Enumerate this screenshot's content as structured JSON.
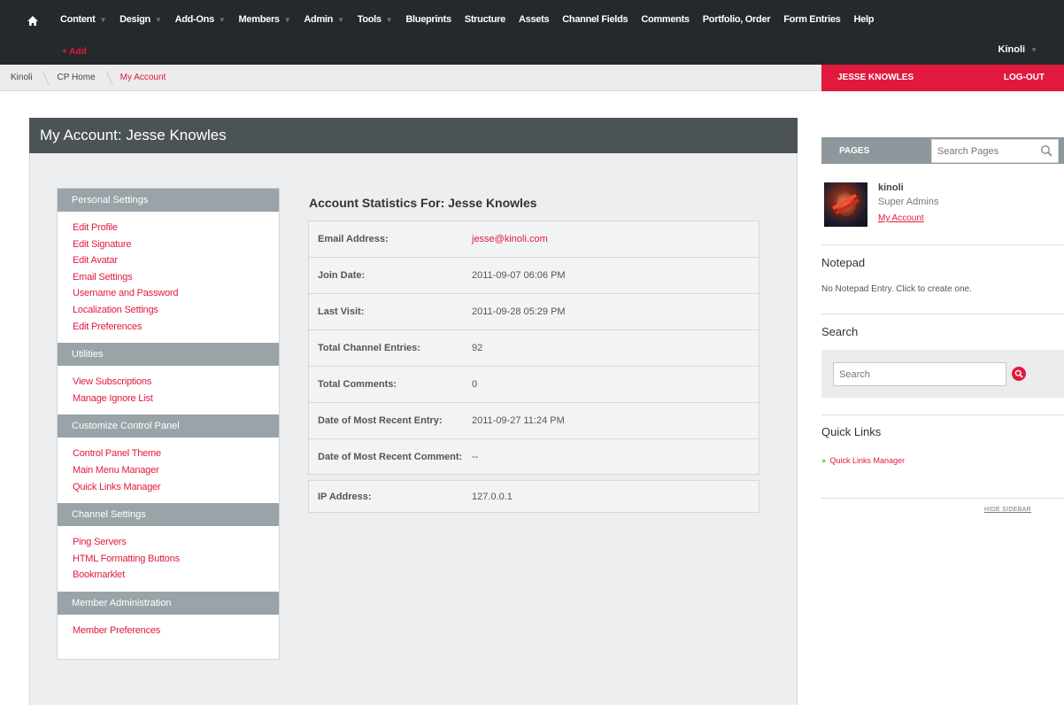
{
  "topnav": {
    "items": [
      {
        "label": "Content",
        "caret": true
      },
      {
        "label": "Design",
        "caret": true
      },
      {
        "label": "Add-Ons",
        "caret": true
      },
      {
        "label": "Members",
        "caret": true
      },
      {
        "label": "Admin",
        "caret": true
      },
      {
        "label": "Tools",
        "caret": true
      },
      {
        "label": "Blueprints",
        "caret": false
      },
      {
        "label": "Structure",
        "caret": false
      },
      {
        "label": "Assets",
        "caret": false
      },
      {
        "label": "Channel Fields",
        "caret": false
      },
      {
        "label": "Comments",
        "caret": false
      },
      {
        "label": "Portfolio, Order",
        "caret": false
      },
      {
        "label": "Form Entries",
        "caret": false
      },
      {
        "label": "Help",
        "caret": false
      }
    ],
    "add_label": "+ Add",
    "site_name": "Kinoli",
    "caret_glyph": "▼",
    "home_icon": "home-icon"
  },
  "breadcrumb": {
    "items": [
      "Kinoli",
      "CP Home",
      "My Account"
    ],
    "user_name": "JESSE KNOWLES",
    "logout_label": "LOG-OUT"
  },
  "main": {
    "title": "My Account: Jesse Knowles"
  },
  "settings": {
    "sections": [
      {
        "title": "Personal Settings",
        "links": [
          "Edit Profile",
          "Edit Signature",
          "Edit Avatar",
          "Email Settings",
          "Username and Password",
          "Localization Settings",
          "Edit Preferences"
        ]
      },
      {
        "title": "Utilities",
        "links": [
          "View Subscriptions",
          "Manage Ignore List"
        ]
      },
      {
        "title": "Customize Control Panel",
        "links": [
          "Control Panel Theme",
          "Main Menu Manager",
          "Quick Links Manager"
        ]
      },
      {
        "title": "Channel Settings",
        "links": [
          "Ping Servers",
          "HTML Formatting Buttons",
          "Bookmarklet"
        ]
      },
      {
        "title": "Member Administration",
        "links": [
          "Member Preferences"
        ]
      }
    ]
  },
  "stats": {
    "title": "Account Statistics For: Jesse Knowles",
    "rows": [
      {
        "label": "Email Address:",
        "value": "jesse@kinoli.com",
        "link": true
      },
      {
        "label": "Join Date:",
        "value": "2011-09-07 06:06 PM",
        "link": false
      },
      {
        "label": "Last Visit:",
        "value": "2011-09-28 05:29 PM",
        "link": false
      },
      {
        "label": "Total Channel Entries:",
        "value": "92",
        "link": false
      },
      {
        "label": "Total Comments:",
        "value": "0",
        "link": false
      },
      {
        "label": "Date of Most Recent Entry:",
        "value": "2011-09-27 11:24 PM",
        "link": false
      },
      {
        "label": "Date of Most Recent Comment:",
        "value": "--",
        "link": false
      }
    ],
    "ip_row": {
      "label": "IP Address:",
      "value": "127.0.0.1"
    }
  },
  "sidebar": {
    "pages_label": "PAGES",
    "pages_search_placeholder": "Search Pages",
    "profile": {
      "name": "kinoli",
      "role": "Super Admins",
      "link": "My Account"
    },
    "notepad_title": "Notepad",
    "notepad_text": "No Notepad Entry. Click to create one.",
    "search_title": "Search",
    "search_placeholder": "Search",
    "quicklinks_title": "Quick Links",
    "quicklinks": [
      "Quick Links Manager"
    ],
    "hide_sidebar": "HIDE SIDEBAR"
  },
  "colors": {
    "accent": "#e1193c",
    "nav_bg": "#25292c",
    "title_bar": "#4b5357",
    "section_head": "#9aa3a8"
  }
}
